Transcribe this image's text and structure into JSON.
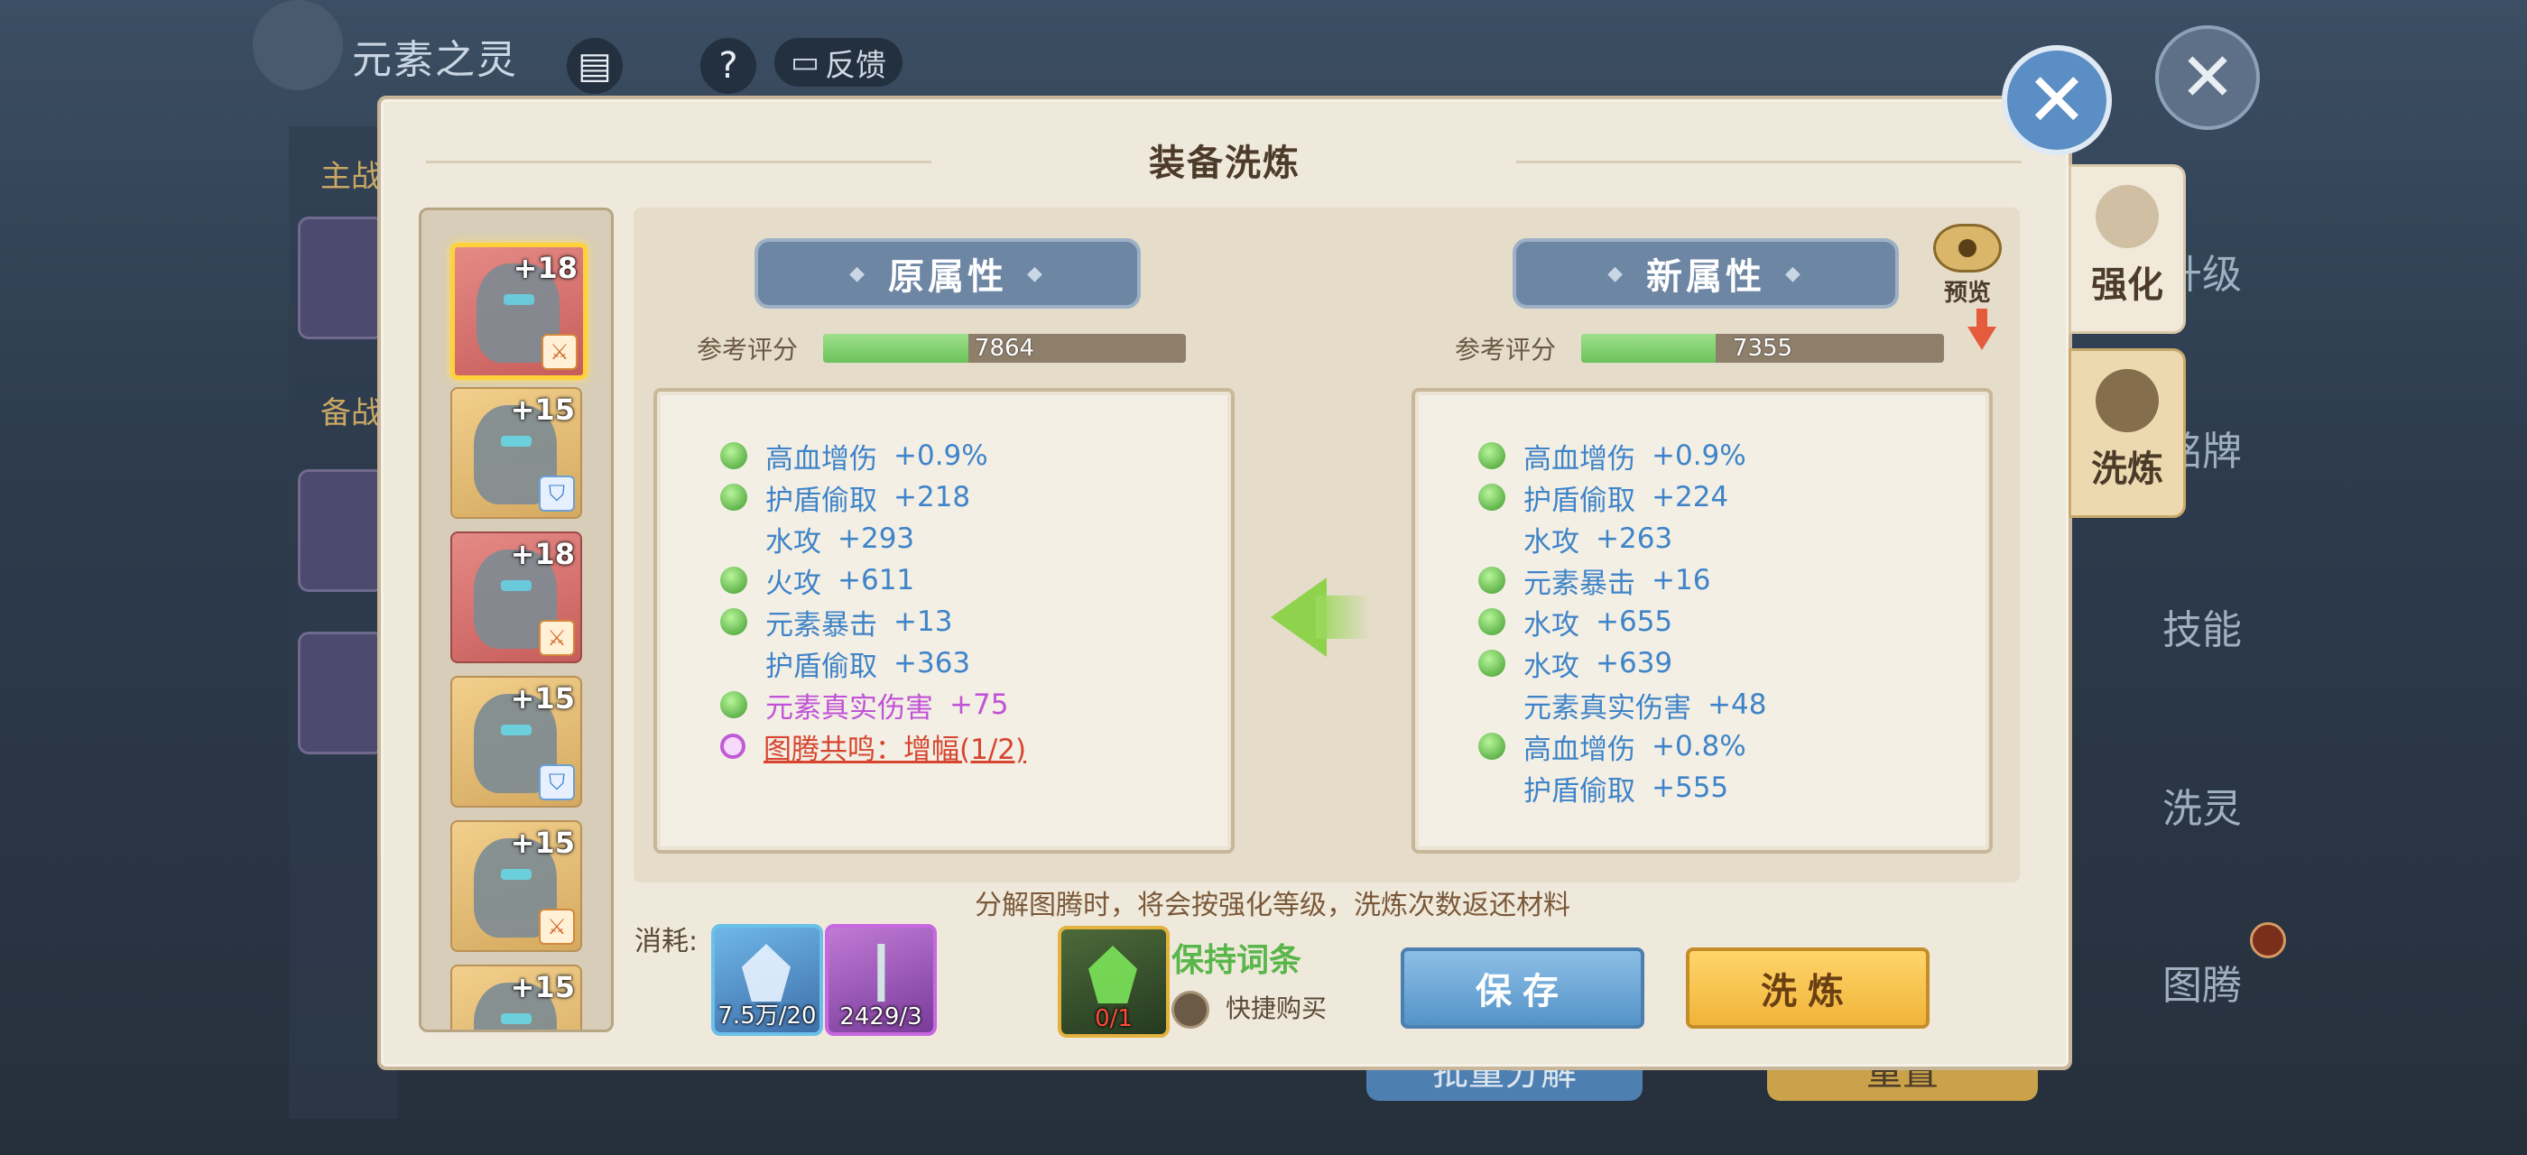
{
  "background": {
    "title": "元素之灵",
    "feedback": "反馈",
    "help": "?",
    "side_labels": [
      "主战",
      "备战"
    ],
    "menu": [
      "升级",
      "铭牌",
      "技能",
      "洗灵",
      "图腾"
    ],
    "bottom_buttons": [
      "批量分解",
      "重置"
    ]
  },
  "dialog": {
    "title": "装备洗炼",
    "items": [
      {
        "level": "+18",
        "frame": "gold",
        "badge": "sword",
        "selected": true
      },
      {
        "level": "+15",
        "frame": "gold",
        "badge": "shield",
        "selected": false
      },
      {
        "level": "+18",
        "frame": "red",
        "badge": "sword",
        "selected": false
      },
      {
        "level": "+15",
        "frame": "gold",
        "badge": "shield",
        "selected": false
      },
      {
        "level": "+15",
        "frame": "gold",
        "badge": "sword",
        "selected": false
      },
      {
        "level": "+15",
        "frame": "gold",
        "badge": "",
        "selected": false
      }
    ],
    "original": {
      "header": "原属性",
      "score_label": "参考评分",
      "score": 7864,
      "score_fraction": 0.4,
      "attributes": [
        {
          "name": "高血增伤",
          "value": "+0.9%",
          "gem": true,
          "style": "normal"
        },
        {
          "name": "护盾偷取",
          "value": "+218",
          "gem": true,
          "style": "normal"
        },
        {
          "name": "水攻",
          "value": "+293",
          "gem": false,
          "style": "normal"
        },
        {
          "name": "火攻",
          "value": "+611",
          "gem": true,
          "style": "normal"
        },
        {
          "name": "元素暴击",
          "value": "+13",
          "gem": true,
          "style": "normal"
        },
        {
          "name": "护盾偷取",
          "value": "+363",
          "gem": false,
          "style": "normal"
        },
        {
          "name": "元素真实伤害",
          "value": "+75",
          "gem": true,
          "style": "purple"
        },
        {
          "name": "图腾共鸣：增幅(1/2)",
          "value": "",
          "gem": true,
          "style": "red"
        }
      ]
    },
    "new": {
      "header": "新属性",
      "score_label": "参考评分",
      "score": 7355,
      "score_fraction": 0.37,
      "preview_label": "预览",
      "attributes": [
        {
          "name": "高血增伤",
          "value": "+0.9%",
          "gem": true
        },
        {
          "name": "护盾偷取",
          "value": "+224",
          "gem": true
        },
        {
          "name": "水攻",
          "value": "+263",
          "gem": false
        },
        {
          "name": "元素暴击",
          "value": "+16",
          "gem": true
        },
        {
          "name": "水攻",
          "value": "+655",
          "gem": true
        },
        {
          "name": "水攻",
          "value": "+639",
          "gem": true
        },
        {
          "name": "元素真实伤害",
          "value": "+48",
          "gem": false
        },
        {
          "name": "高血增伤",
          "value": "+0.8%",
          "gem": true
        },
        {
          "name": "护盾偷取",
          "value": "+555",
          "gem": false
        }
      ]
    },
    "note": "分解图腾时，将会按强化等级，洗炼次数返还材料",
    "cost_label": "消耗:",
    "materials": [
      {
        "name": "crystal",
        "count": "7.5万/20"
      },
      {
        "name": "branch",
        "count": "2429/3"
      }
    ],
    "keep": {
      "count": "0/1",
      "label": "保持词条",
      "quick_buy": "快捷购买"
    },
    "save_button": "保存",
    "refine_button": "洗炼"
  },
  "side_tabs": [
    {
      "label": "强化",
      "active": false
    },
    {
      "label": "洗炼",
      "active": true
    }
  ],
  "colors": {
    "attr_blue": "#3f84c8",
    "attr_purple": "#c153d6",
    "attr_red": "#d7452f",
    "save_blue": "#5593c8",
    "refine_gold": "#f0b43a"
  }
}
